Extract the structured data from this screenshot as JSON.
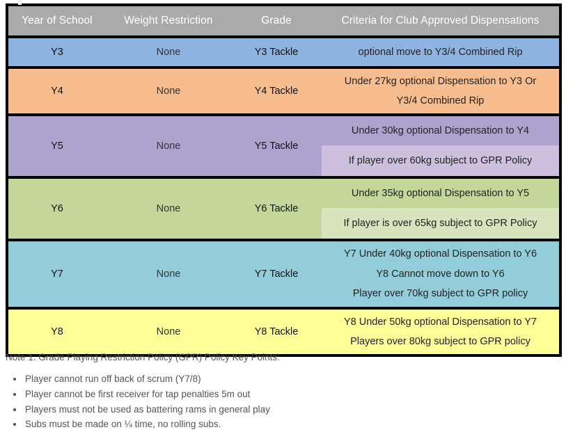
{
  "table": {
    "headers": [
      "Year of School",
      "Weight Restriction",
      "Grade",
      "Criteria for Club Approved Dispensations"
    ],
    "rows": [
      {
        "year": "Y3",
        "weight": "None",
        "grade": "Y3 Tackle",
        "color": "#8fb3e0",
        "criteria": [
          "optional move to Y3/4 Combined Rip"
        ],
        "sub": null
      },
      {
        "year": "Y4",
        "weight": "None",
        "grade": "Y4 Tackle",
        "color": "#f8bd8e",
        "criteria": [
          "Under 27kg optional Dispensation to Y3 Or",
          "Y3/4 Combined Rip"
        ],
        "sub": null
      },
      {
        "year": "Y5",
        "weight": "None",
        "grade": "Y5 Tackle",
        "color": "#b0a2ce",
        "criteria": [
          "Under 30kg optional Dispensation to Y4"
        ],
        "sub": {
          "color": "#cdc0de",
          "criteria": [
            "If player over 60kg subject to GPR Policy"
          ]
        }
      },
      {
        "year": "Y6",
        "weight": "None",
        "grade": "Y6 Tackle",
        "color": "#c3d79b",
        "criteria": [
          "Under 35kg optional Dispensation to Y5"
        ],
        "sub": {
          "color": "#d8e4bd",
          "criteria": [
            "If player is over 65kg subject to GPR Policy"
          ]
        }
      },
      {
        "year": "Y7",
        "weight": "None",
        "grade": "Y7 Tackle",
        "color": "#93cdda",
        "criteria": [
          "Y7 Under 40kg optional Dispensation to Y6",
          "Y8 Cannot move down to Y6",
          "Player over 70kg subject to GPR policy"
        ],
        "sub": null
      },
      {
        "year": "Y8",
        "weight": "None",
        "grade": "Y8 Tackle",
        "color": "#ffff99",
        "criteria": [
          "Y8 Under 50kg optional Dispensation to Y7",
          "Players over 80kg subject to GPR policy"
        ],
        "sub": null
      }
    ]
  },
  "notes": {
    "title": "Note 1. Grade Playing Restriction Policy (GPR) Policy Key Points:",
    "items": [
      "Player cannot run off back of scrum (Y7/8)",
      "Player cannot be first receiver for tap penalties 5m out",
      "Players must not be used as battering rams in general play",
      "Subs must be made on ¼ time, no rolling subs."
    ]
  },
  "colors": {
    "header_bg": "#aaaaaa",
    "border": "#000000",
    "notes_text": "#555555"
  }
}
